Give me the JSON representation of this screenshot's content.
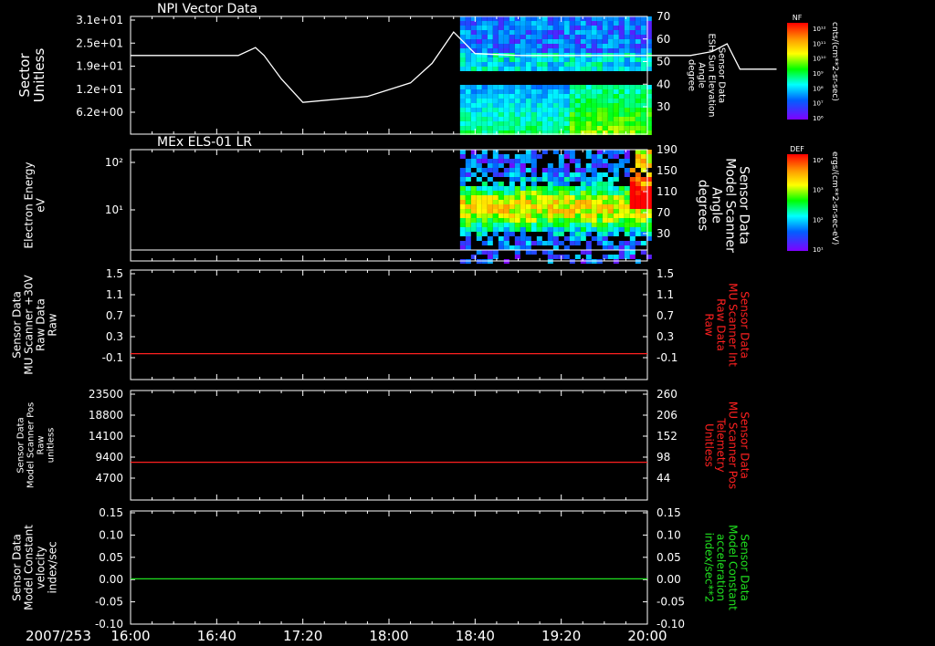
{
  "date_label": "2007/253",
  "time_ticks": [
    "16:00",
    "16:40",
    "17:20",
    "18:00",
    "18:40",
    "19:20",
    "20:00"
  ],
  "colors": {
    "background": "#000000",
    "axis": "#ffffff",
    "red_trace": "#ff2020",
    "green_trace": "#20e020",
    "right_label_red": "#ff2020",
    "right_label_green": "#20e020"
  },
  "colorbars": [
    {
      "title": "NF",
      "units": "cnts/(cm**2-sr-sec)",
      "tick_labels": [
        "10¹²",
        "10¹¹",
        "10¹⁰",
        "10⁹",
        "10⁸",
        "10⁷",
        "10⁶"
      ]
    },
    {
      "title": "DEF",
      "units": "ergs/(cm**2-sr-sec-eV)",
      "tick_labels": [
        "10⁴",
        "10³",
        "10²",
        "10¹"
      ]
    }
  ],
  "chart_data": [
    {
      "type": "line",
      "title": "NPI Vector Data",
      "ylabel": [
        "Sector",
        "Unitless"
      ],
      "ytick_labels": [
        "3.1e+01",
        "2.5e+01",
        "1.9e+01",
        "1.2e+01",
        "6.2e+00"
      ],
      "y2label": [
        "Sensor Data",
        "ESH Sun Elevation",
        "Angle",
        "degree"
      ],
      "y2tick_labels": [
        "70",
        "60",
        "50",
        "40",
        "30"
      ],
      "y2lim": [
        20,
        70
      ],
      "line_series": {
        "name": "",
        "x_minutes_after_16": [
          0,
          50,
          58,
          62,
          70,
          80,
          110,
          130,
          140,
          150,
          160,
          180,
          230,
          260,
          270,
          277,
          283,
          290,
          300
        ],
        "y2_deg": [
          50,
          50,
          54,
          50,
          38,
          26,
          29,
          36,
          46,
          62,
          51,
          50,
          50,
          50,
          52,
          56,
          43,
          43,
          43
        ]
      },
      "spectrogram": {
        "x_start_minutes_after_16": 153,
        "x_end_minutes_after_16": 240,
        "colorbar": "NF"
      }
    },
    {
      "type": "heatmap",
      "title": "MEx ELS-01 LR",
      "ylabel": [
        "Electron Energy",
        "eV"
      ],
      "ytick_labels": [
        "10²",
        "10¹"
      ],
      "y2label": [
        "Sensor Data",
        "Model Scanner",
        "Angle",
        "degrees"
      ],
      "y2tick_labels": [
        "190",
        "150",
        "110",
        "70",
        "30"
      ],
      "y2lim": [
        0,
        190
      ],
      "line_series": {
        "x_minutes_after_16": [
          0,
          240
        ],
        "y2_deg": [
          0,
          0
        ]
      },
      "spectrogram": {
        "x_start_minutes_after_16": 153,
        "x_end_minutes_after_16": 240,
        "colorbar": "DEF"
      }
    },
    {
      "type": "line",
      "title": "",
      "ylabel": [
        "Sensor Data",
        "MU Scanner +30V",
        "Raw Data",
        "Raw"
      ],
      "ytick_labels": [
        "1.5",
        "1.1",
        "0.7",
        "0.3",
        "-0.1"
      ],
      "ylim": [
        -0.4,
        1.5
      ],
      "y2label": [
        "Sensor Data",
        "MU Scanner Int",
        "Raw Data",
        "Raw"
      ],
      "y2tick_labels": [
        "1.5",
        "1.1",
        "0.7",
        "0.3",
        "-0.1"
      ],
      "series": [
        {
          "name": "",
          "color": "red",
          "x_minutes_after_16": [
            0,
            240
          ],
          "values": [
            0.05,
            0.05
          ]
        }
      ]
    },
    {
      "type": "line",
      "title": "",
      "ylabel": [
        "Sensor Data",
        "Model Scanner Pos",
        "Raw",
        "unitless"
      ],
      "ytick_labels": [
        "23500",
        "18800",
        "14100",
        "9400",
        "4700"
      ],
      "ylim": [
        0,
        23500
      ],
      "y2label": [
        "Sensor Data",
        "MU Scanner Pos",
        "Telemetry",
        "Unitless"
      ],
      "y2tick_labels": [
        "260",
        "206",
        "152",
        "98",
        "44"
      ],
      "series": [
        {
          "name": "",
          "color": "red",
          "x_minutes_after_16": [
            0,
            240
          ],
          "values": [
            8100,
            8100
          ]
        }
      ]
    },
    {
      "type": "line",
      "title": "",
      "ylabel": [
        "Sensor Data",
        "Model Constant",
        "velocity",
        "index/sec"
      ],
      "ytick_labels": [
        "0.15",
        "0.10",
        "0.05",
        "0.00",
        "-0.05",
        "-0.10"
      ],
      "ylim": [
        -0.1,
        0.15
      ],
      "y2label": [
        "Sensor Data",
        "Model Constant",
        "acceleration",
        "index/sec**2"
      ],
      "y2tick_labels": [
        "0.15",
        "0.10",
        "0.05",
        "0.00",
        "-0.05",
        "-0.10"
      ],
      "series": [
        {
          "name": "",
          "color": "green",
          "x_minutes_after_16": [
            0,
            240
          ],
          "values": [
            0.0,
            0.0
          ]
        }
      ]
    }
  ]
}
